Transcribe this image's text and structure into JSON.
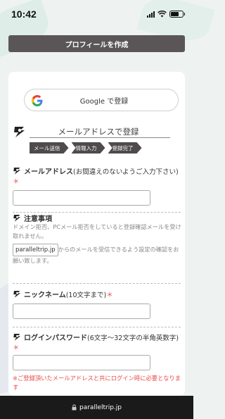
{
  "status": {
    "time": "10:42"
  },
  "page": {
    "title": "プロフィールを作成"
  },
  "google": {
    "button_label": "Google で登録"
  },
  "section": {
    "title": "メールアドレスで登録"
  },
  "steps": [
    "メール送信",
    "情報入力",
    "登録完了"
  ],
  "fields": {
    "email": {
      "label": "メールアドレス",
      "hint": "(お間違えのないようご入力下さい)",
      "required": "＊",
      "value": ""
    },
    "notice": {
      "title": "注意事項",
      "text": "ドメイン拒否、PCメール拒否をしていると登録確認メールを受け取れません。",
      "domain": "paralleltrip.jp",
      "text2": "からのメールを受信できるよう設定の確認をお願い致します。"
    },
    "nickname": {
      "label": "ニックネーム",
      "hint": "(10文字まで)",
      "required": "＊",
      "value": ""
    },
    "password": {
      "label": "ログインパスワード",
      "hint": "(6文字〜32文字の半角英数字)",
      "required": "＊",
      "value": ""
    }
  },
  "note": "※ご登録頂いたメールアドレスと共にログイン時に必要となります",
  "browser": {
    "url": "paralleltrip.jp"
  },
  "colors": {
    "accent_red": "#e84a4a",
    "title_bar": "#5a5657",
    "step_bg": "#4f4b4c"
  }
}
